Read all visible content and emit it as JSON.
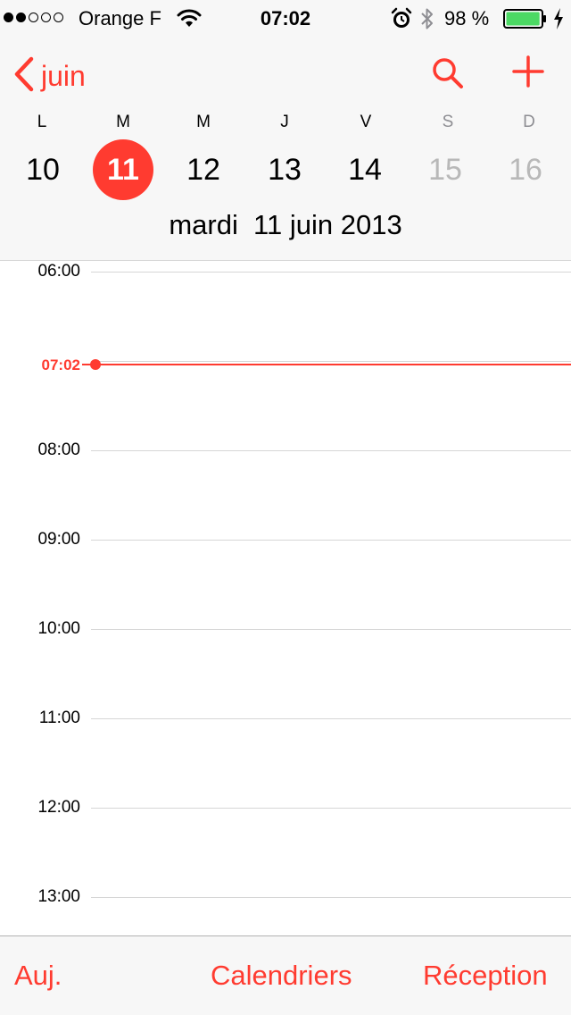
{
  "status_bar": {
    "signal_bars_filled": 2,
    "signal_bars_total": 5,
    "carrier": "Orange F",
    "time": "07:02",
    "battery_percent": "98 %",
    "battery_level": 0.98,
    "icons": [
      "wifi-icon",
      "alarm-icon",
      "bluetooth-icon",
      "battery-icon",
      "charging-icon"
    ]
  },
  "nav": {
    "back_label": "juin",
    "search_icon": "search-icon",
    "add_icon": "plus-icon"
  },
  "week": {
    "weekdays": [
      "L",
      "M",
      "M",
      "J",
      "V",
      "S",
      "D"
    ],
    "days": [
      "10",
      "11",
      "12",
      "13",
      "14",
      "15",
      "16"
    ],
    "selected_index": 1
  },
  "date_title": "mardi  11 juin 2013",
  "timeline": {
    "hours": [
      "06:00",
      "08:00",
      "09:00",
      "10:00",
      "11:00",
      "12:00",
      "13:00"
    ],
    "current_time": "07:02"
  },
  "toolbar": {
    "today": "Auj.",
    "calendars": "Calendriers",
    "inbox": "Réception"
  },
  "colors": {
    "accent": "#ff3b30",
    "weekend_text": "#b8b8b8",
    "battery": "#4cd964"
  }
}
